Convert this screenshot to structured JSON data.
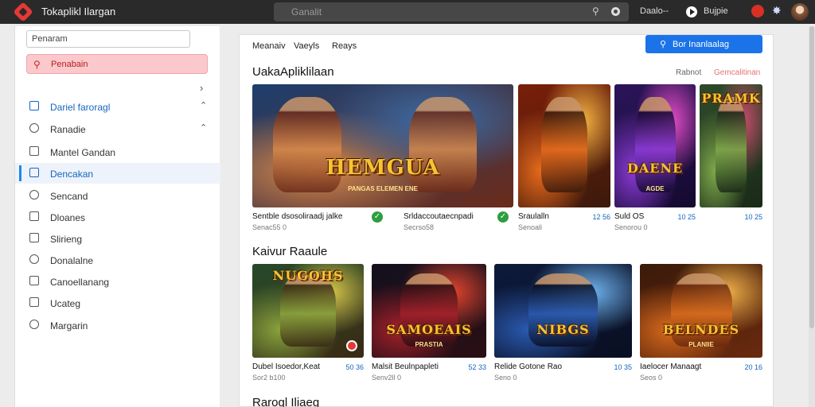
{
  "topbar": {
    "app_title": "Tokaplikl Ilargan",
    "search_placeholder": "Ganalit",
    "action_1": "Daalo--",
    "action_2": "Bujpie",
    "logo_icon": "diamond-logo-icon",
    "play_icon": "play-circle-icon",
    "notification_icon": "red-dot-icon",
    "settings_icon": "star-gear-icon"
  },
  "sidebar": {
    "search_value": "Penaram",
    "active_item": {
      "label": "Penabain",
      "icon": "search-icon"
    },
    "items": [
      {
        "label": "Dariel faroragl",
        "icon": "calendar-icon",
        "blue": true,
        "chevron": "^"
      },
      {
        "label": "Ranadie",
        "icon": "circle-icon",
        "chevron": "^"
      },
      {
        "label": "Mantel Gandan",
        "icon": "folder-icon"
      },
      {
        "label": "Dencakan",
        "icon": "window-icon",
        "blue": true,
        "selected": true
      },
      {
        "label": "Sencand",
        "icon": "chat-icon"
      },
      {
        "label": "Dloanes",
        "icon": "doc-icon"
      },
      {
        "label": "Slirieng",
        "icon": "target-icon"
      },
      {
        "label": "Donalalne",
        "icon": "dollar-icon"
      },
      {
        "label": "Canoellanang",
        "icon": "clock-icon"
      },
      {
        "label": "Ucateg",
        "icon": "toggle-icon"
      },
      {
        "label": "Margarin",
        "icon": "box-icon"
      }
    ]
  },
  "main": {
    "tabs": [
      "Meanaiv",
      "Vaeyls",
      "Reays"
    ],
    "cta_label": "Bor Inanlaalag",
    "section1": {
      "title": "UakaApliklilaan",
      "link_a": "Rabnot",
      "link_b": "Gemcalitinan",
      "cards": [
        {
          "art_title": "HEMGUA",
          "art_sub": "PANGAS ELEMEN ENE",
          "name": "Sentble dsosoliraadj jalke",
          "sub": "Senac55 0",
          "verified": true,
          "palette": "blue"
        },
        {
          "art_title": "",
          "art_sub": "",
          "name": "Srldaccoutaecnpadi",
          "sub": "Secrso58",
          "price": "",
          "verified": true,
          "palette": "blue"
        },
        {
          "art_title": "",
          "art_sub": "",
          "name": "Sraulalln",
          "sub": "Senoali",
          "price": "12 56",
          "palette": "fire"
        },
        {
          "art_title": "DAENE",
          "art_sub": "AGDE",
          "name": "Suld OS",
          "sub": "Senorou 0",
          "price": "10 25",
          "palette": "purple"
        },
        {
          "art_title": "PRAMK",
          "art_sub": "",
          "name": "",
          "sub": "",
          "price": "10 25",
          "palette": "green"
        }
      ]
    },
    "section2": {
      "title": "Kaivur Raaule",
      "cards": [
        {
          "art_title": "NUGOHS",
          "art_sub": "",
          "name": "Dubel Isoedor,Keat",
          "sub": "Sor2 b100",
          "price": "50 36",
          "palette": "jungle",
          "badge": true
        },
        {
          "art_title": "SAMOEAIS",
          "art_sub": "PRASTIA",
          "name": "Malsit Beulnpapleti",
          "sub": "Senv2ll 0",
          "price": "52 33",
          "palette": "red"
        },
        {
          "art_title": "NIBGS",
          "art_sub": "",
          "name": "Relide Gotone Rao",
          "sub": "Seno 0",
          "price": "10 35",
          "palette": "navy"
        },
        {
          "art_title": "BELNDES",
          "art_sub": "PLANIIE",
          "name": "Iaelocer Manaagt",
          "sub": "Seos 0",
          "price": "20 16",
          "palette": "sunset"
        }
      ]
    },
    "section3": {
      "title": "Rarogl Iliaeg"
    }
  }
}
